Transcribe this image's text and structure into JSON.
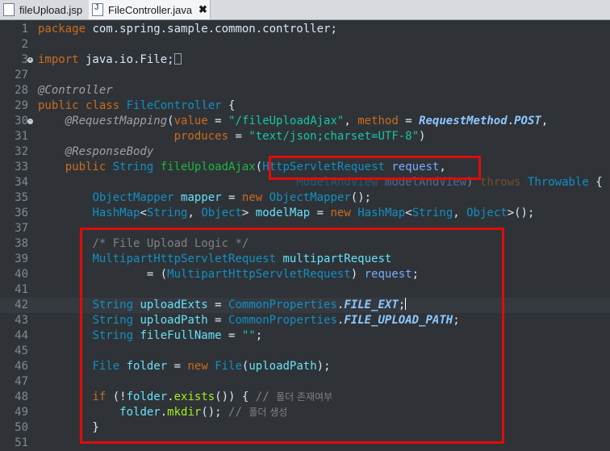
{
  "tabs": [
    {
      "label": "fileUpload.jsp",
      "icon": "jsp-file-icon",
      "active": false
    },
    {
      "label": "FileController.java",
      "icon": "java-file-icon",
      "active": true,
      "close": "✖"
    }
  ],
  "lines": [
    {
      "n": "1",
      "tokens": [
        [
          "t-key",
          "package"
        ],
        [
          "t-plain",
          " com.spring.sample.common.controller;"
        ]
      ]
    },
    {
      "n": "2",
      "tokens": []
    },
    {
      "n": "3",
      "fold": "+",
      "tokens": [
        [
          "t-key",
          "import"
        ],
        [
          "t-plain",
          " java.io.File;"
        ],
        [
          "box",
          ""
        ]
      ]
    },
    {
      "n": "27",
      "tokens": []
    },
    {
      "n": "28",
      "tokens": [
        [
          "t-ann",
          "@Controller"
        ]
      ]
    },
    {
      "n": "29",
      "tokens": [
        [
          "t-key",
          "public"
        ],
        [
          "t-plain",
          " "
        ],
        [
          "t-key",
          "class"
        ],
        [
          "t-plain",
          " "
        ],
        [
          "t-type",
          "FileController"
        ],
        [
          "t-plain",
          " {"
        ]
      ]
    },
    {
      "n": "30",
      "fold": "-",
      "tokens": [
        [
          "t-plain",
          "    "
        ],
        [
          "t-ann",
          "@RequestMapping"
        ],
        [
          "t-plain",
          "("
        ],
        [
          "t-key",
          "value"
        ],
        [
          "t-plain",
          " = "
        ],
        [
          "t-str",
          "\"/fileUploadAjax\""
        ],
        [
          "t-plain",
          ", "
        ],
        [
          "t-key",
          "method"
        ],
        [
          "t-plain",
          " = "
        ],
        [
          "t-field",
          "RequestMethod"
        ],
        [
          "t-plain",
          "."
        ],
        [
          "t-const",
          "POST"
        ],
        [
          "t-plain",
          ","
        ]
      ]
    },
    {
      "n": "31",
      "tokens": [
        [
          "t-plain",
          "                    "
        ],
        [
          "t-key",
          "produces"
        ],
        [
          "t-plain",
          " = "
        ],
        [
          "t-str",
          "\"text/json;charset=UTF-8\""
        ],
        [
          "t-plain",
          ")"
        ]
      ]
    },
    {
      "n": "32",
      "tokens": [
        [
          "t-plain",
          "    "
        ],
        [
          "t-ann",
          "@ResponseBody"
        ]
      ]
    },
    {
      "n": "33",
      "tokens": [
        [
          "t-plain",
          "    "
        ],
        [
          "t-key",
          "public"
        ],
        [
          "t-plain",
          " "
        ],
        [
          "t-type",
          "String"
        ],
        [
          "t-plain",
          " "
        ],
        [
          "t-method",
          "fileUploadAjax"
        ],
        [
          "t-plain",
          "("
        ],
        [
          "t-type",
          "HttpServletRequest"
        ],
        [
          "t-plain",
          " "
        ],
        [
          "t-param",
          "request"
        ],
        [
          "t-plain",
          ","
        ]
      ]
    },
    {
      "n": "34",
      "tokens": [
        [
          "t-plain",
          "                                      "
        ],
        [
          "t-type t-dim",
          "ModelAndView"
        ],
        [
          "t-plain t-dim",
          " "
        ],
        [
          "t-param t-dim",
          "modelAndView"
        ],
        [
          "t-plain t-dim",
          ") "
        ],
        [
          "t-key t-dim",
          "throws"
        ],
        [
          "t-plain",
          " "
        ],
        [
          "t-type",
          "Throwable"
        ],
        [
          "t-plain",
          " {"
        ]
      ]
    },
    {
      "n": "35",
      "tokens": [
        [
          "t-plain",
          "        "
        ],
        [
          "t-type",
          "ObjectMapper"
        ],
        [
          "t-plain",
          " "
        ],
        [
          "t-var",
          "mapper"
        ],
        [
          "t-plain",
          " = "
        ],
        [
          "t-key",
          "new"
        ],
        [
          "t-plain",
          " "
        ],
        [
          "t-type",
          "ObjectMapper"
        ],
        [
          "t-plain",
          "();"
        ]
      ]
    },
    {
      "n": "36",
      "tokens": [
        [
          "t-plain",
          "        "
        ],
        [
          "t-type",
          "HashMap"
        ],
        [
          "t-plain",
          "<"
        ],
        [
          "t-type",
          "String"
        ],
        [
          "t-plain",
          ", "
        ],
        [
          "t-type",
          "Object"
        ],
        [
          "t-plain",
          "> "
        ],
        [
          "t-var",
          "modelMap"
        ],
        [
          "t-plain",
          " = "
        ],
        [
          "t-key",
          "new"
        ],
        [
          "t-plain",
          " "
        ],
        [
          "t-type",
          "HashMap"
        ],
        [
          "t-plain",
          "<"
        ],
        [
          "t-type",
          "String"
        ],
        [
          "t-plain",
          ", "
        ],
        [
          "t-type",
          "Object"
        ],
        [
          "t-plain",
          ">();"
        ]
      ]
    },
    {
      "n": "37",
      "tokens": []
    },
    {
      "n": "38",
      "tokens": [
        [
          "t-plain",
          "        "
        ],
        [
          "t-com",
          "/* File Upload Logic */"
        ]
      ]
    },
    {
      "n": "39",
      "tokens": [
        [
          "t-plain",
          "        "
        ],
        [
          "t-type",
          "MultipartHttpServletRequest"
        ],
        [
          "t-plain",
          " "
        ],
        [
          "t-var",
          "multipartRequest"
        ]
      ]
    },
    {
      "n": "40",
      "tokens": [
        [
          "t-plain",
          "                = ("
        ],
        [
          "t-type",
          "MultipartHttpServletRequest"
        ],
        [
          "t-plain",
          ") "
        ],
        [
          "t-param",
          "request"
        ],
        [
          "t-plain",
          ";"
        ]
      ]
    },
    {
      "n": "41",
      "tokens": []
    },
    {
      "n": "42",
      "caret": true,
      "tokens": [
        [
          "t-plain",
          "        "
        ],
        [
          "t-type",
          "String"
        ],
        [
          "t-plain",
          " "
        ],
        [
          "t-var",
          "uploadExts"
        ],
        [
          "t-plain",
          " = "
        ],
        [
          "t-type",
          "CommonProperties"
        ],
        [
          "t-plain",
          "."
        ],
        [
          "t-const",
          "FILE_EXT"
        ],
        [
          "t-plain",
          ";"
        ],
        [
          "cursor",
          ""
        ]
      ]
    },
    {
      "n": "43",
      "tokens": [
        [
          "t-plain",
          "        "
        ],
        [
          "t-type",
          "String"
        ],
        [
          "t-plain",
          " "
        ],
        [
          "t-var",
          "uploadPath"
        ],
        [
          "t-plain",
          " = "
        ],
        [
          "t-type",
          "CommonProperties"
        ],
        [
          "t-plain",
          "."
        ],
        [
          "t-const",
          "FILE_UPLOAD_PATH"
        ],
        [
          "t-plain",
          ";"
        ]
      ]
    },
    {
      "n": "44",
      "tokens": [
        [
          "t-plain",
          "        "
        ],
        [
          "t-type",
          "String"
        ],
        [
          "t-plain",
          " "
        ],
        [
          "t-var",
          "fileFullName"
        ],
        [
          "t-plain",
          " = "
        ],
        [
          "t-str",
          "\"\""
        ],
        [
          "t-plain",
          ";"
        ]
      ]
    },
    {
      "n": "45",
      "tokens": []
    },
    {
      "n": "46",
      "tokens": [
        [
          "t-plain",
          "        "
        ],
        [
          "t-type",
          "File"
        ],
        [
          "t-plain",
          " "
        ],
        [
          "t-var",
          "folder"
        ],
        [
          "t-plain",
          " = "
        ],
        [
          "t-key",
          "new"
        ],
        [
          "t-plain",
          " "
        ],
        [
          "t-type",
          "File"
        ],
        [
          "t-plain",
          "("
        ],
        [
          "t-var",
          "uploadPath"
        ],
        [
          "t-plain",
          ");"
        ]
      ]
    },
    {
      "n": "47",
      "tokens": []
    },
    {
      "n": "48",
      "tokens": [
        [
          "t-plain",
          "        "
        ],
        [
          "t-key",
          "if"
        ],
        [
          "t-plain",
          " (!"
        ],
        [
          "t-var",
          "folder"
        ],
        [
          "t-plain",
          "."
        ],
        [
          "t-methcall",
          "exists"
        ],
        [
          "t-plain",
          "()) { "
        ],
        [
          "t-com",
          "// "
        ],
        [
          "t-comk",
          "폴더 존재여부"
        ]
      ]
    },
    {
      "n": "49",
      "tokens": [
        [
          "t-plain",
          "            "
        ],
        [
          "t-var",
          "folder"
        ],
        [
          "t-plain",
          "."
        ],
        [
          "t-methcall",
          "mkdir"
        ],
        [
          "t-plain",
          "(); "
        ],
        [
          "t-com",
          "// "
        ],
        [
          "t-comk",
          "폴더 생성"
        ]
      ]
    },
    {
      "n": "50",
      "tokens": [
        [
          "t-plain",
          "        }"
        ]
      ]
    },
    {
      "n": "51",
      "tokens": []
    }
  ]
}
